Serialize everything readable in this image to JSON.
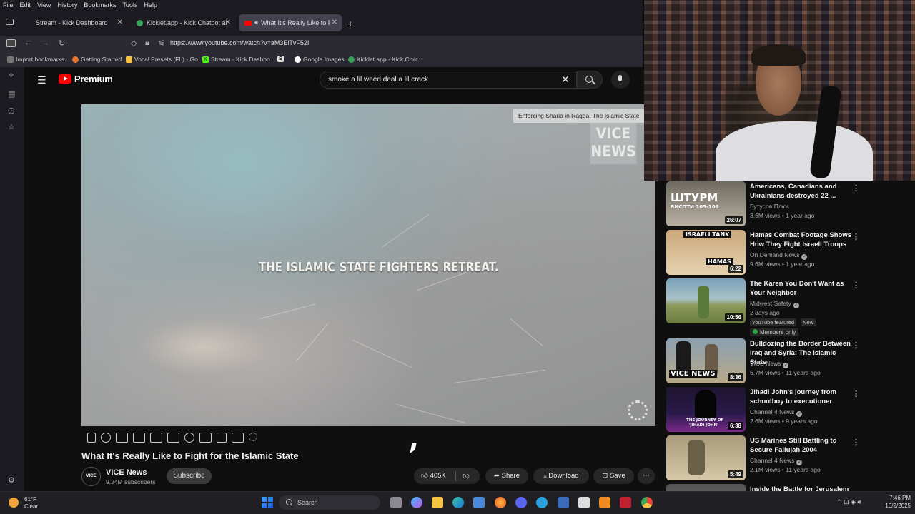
{
  "menubar": {
    "items": [
      "File",
      "Edit",
      "View",
      "History",
      "Bookmarks",
      "Tools",
      "Help"
    ]
  },
  "tabs": [
    {
      "label": "Stream - Kick Dashboard"
    },
    {
      "label": "Kicklet.app - Kick Chatbot and C"
    },
    {
      "label": "What It's Really Like to Figh",
      "active": true
    }
  ],
  "nav": {
    "url": "https://www.youtube.com/watch?v=aM3ElTvF52I"
  },
  "bookmarks": [
    {
      "label": "Import bookmarks..."
    },
    {
      "label": "Getting Started"
    },
    {
      "label": "Vocal Presets (FL) - Go..."
    },
    {
      "label": "Stream - Kick Dashbo..."
    },
    {
      "label": "S"
    },
    {
      "label": "Google Images"
    },
    {
      "label": "Kicklet.app - Kick Chat..."
    }
  ],
  "youtube": {
    "logo_label": "Premium",
    "search_value": "smoke a lil weed deal a lil crack"
  },
  "video": {
    "caption": "THE ISLAMIC STATE FIGHTERS RETREAT.",
    "watermark_line1": "VICE",
    "watermark_line2": "NEWS",
    "info_card": "Enforcing Sharia in Raqqa: The Islamic State",
    "title": "What It's Really Like to Fight for the Islamic State",
    "channel": "VICE News",
    "channel_avatar_text": "VICE News",
    "subscribers": "9.24M subscribers",
    "subscribe_label": "Subscribe",
    "likes": "405K",
    "share_label": "Share",
    "download_label": "Download",
    "save_label": "Save"
  },
  "recommendations": [
    {
      "title": "Americans, Canadians and Ukrainians destroyed 22 ...",
      "channel": "Бутусов Плюс",
      "meta": "3.6M views • 1 year ago",
      "duration": "26:07",
      "thumb_text": "ШТУРМ",
      "thumb_sub": "ВИСОТИ 105-106",
      "thumb_colors": [
        "#6f6a60",
        "#b9b2a3"
      ],
      "verified": false
    },
    {
      "title": "Hamas Combat Footage Shows How They Fight Israeli Troops",
      "channel": "On Demand News",
      "meta": "9.6M views • 1 year ago",
      "duration": "6:22",
      "thumb_text": "ISRAELI TANK",
      "thumb_sub": "HAMAS",
      "thumb_colors": [
        "#c9a77a",
        "#e6d2b0"
      ],
      "verified": true
    },
    {
      "title": "The Karen You Don't Want as Your Neighbor",
      "channel": "Midwest Safety",
      "meta": "2 days ago",
      "duration": "10:56",
      "thumb_text": "",
      "thumb_sub": "",
      "thumb_colors": [
        "#7aa0b8",
        "#8c9a5a"
      ],
      "verified": true,
      "badge_featured": "YouTube featured",
      "badge_new": "New",
      "members": "Members only"
    },
    {
      "title": "Bulldozing the Border Between Iraq and Syria: The Islamic State",
      "channel": "VICE News",
      "meta": "6.7M views • 11 years ago",
      "duration": "8:36",
      "thumb_text": "VICE NEWS",
      "thumb_sub": "",
      "thumb_colors": [
        "#8aa0b0",
        "#b8a888"
      ],
      "verified": true
    },
    {
      "title": "Jihadi John's journey from schoolboy to executioner",
      "channel": "Channel 4 News",
      "meta": "2.6M views • 9 years ago",
      "duration": "6:38",
      "thumb_text": "THE JOURNEY OF",
      "thumb_sub": "'JIHADI JOHN'",
      "thumb_colors": [
        "#2a1a4a",
        "#7a2a8a"
      ],
      "verified": true
    },
    {
      "title": "US Marines Still Battling to Secure Fallujah 2004",
      "channel": "Channel 4 News",
      "meta": "2.1M views • 11 years ago",
      "duration": "5:49",
      "thumb_text": "",
      "thumb_sub": "",
      "thumb_colors": [
        "#a89a7a",
        "#d6c8a8"
      ],
      "verified": true
    },
    {
      "title": "Inside the Battle for Jerusalem",
      "channel": "",
      "meta": "",
      "duration": "",
      "thumb_text": "",
      "thumb_sub": "",
      "thumb_colors": [
        "#555",
        "#777"
      ],
      "verified": false
    }
  ],
  "taskbar": {
    "temp": "61°F",
    "condition": "Clear",
    "search_label": "Search",
    "time": "7:46 PM",
    "date": "10/2/2025"
  }
}
